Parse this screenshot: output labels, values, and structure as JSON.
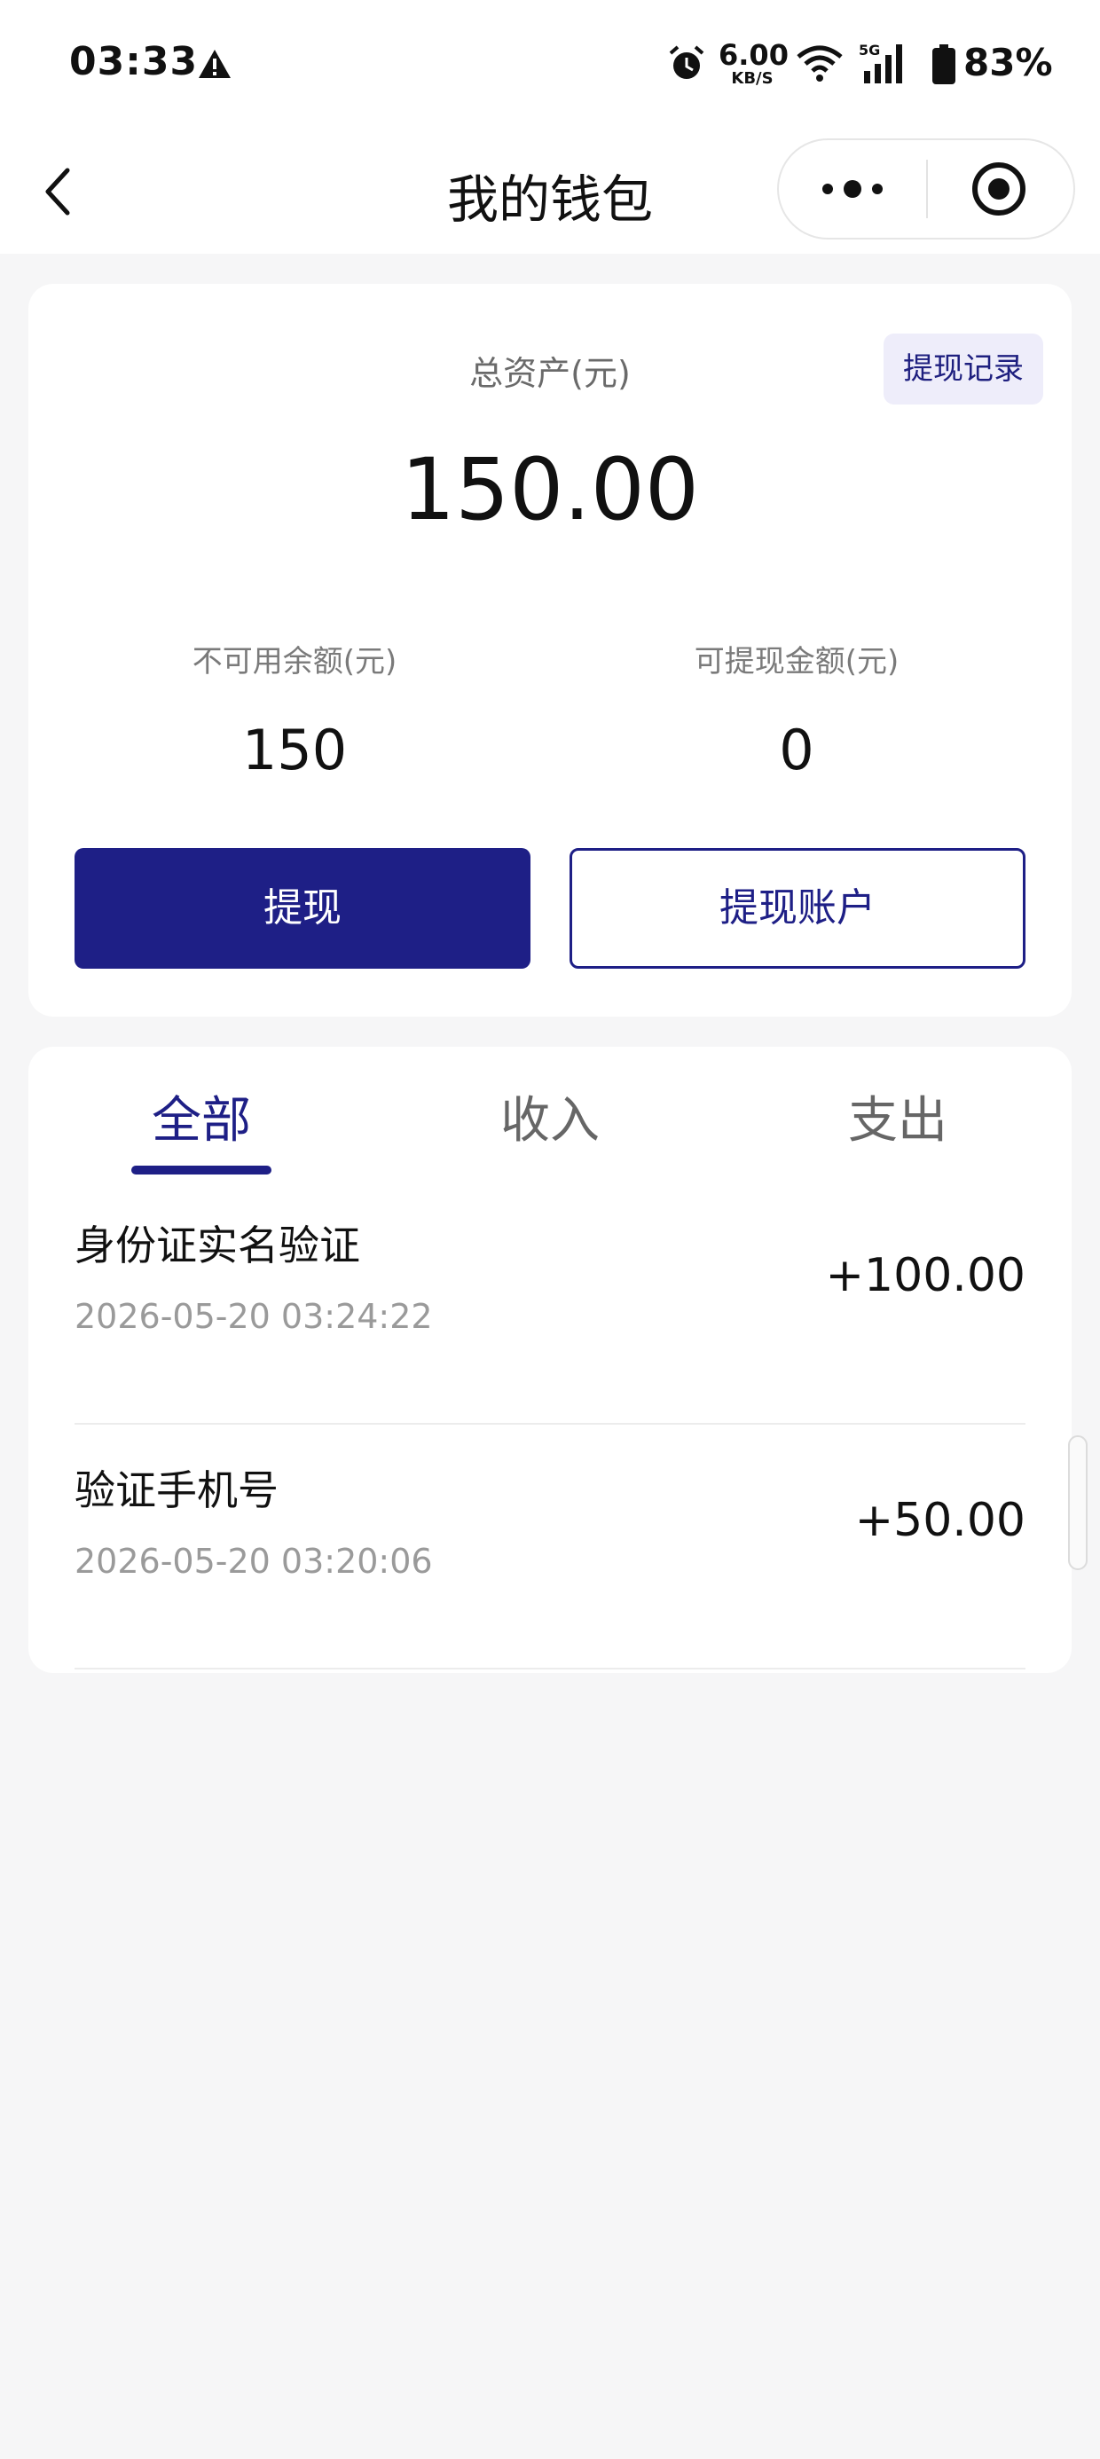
{
  "status_bar": {
    "time": "03:33",
    "net_speed_value": "6.00",
    "net_speed_unit": "KB/S",
    "network": "5G",
    "battery": "83%"
  },
  "nav": {
    "title": "我的钱包"
  },
  "wallet": {
    "total_label": "总资产(元)",
    "record_button": "提现记录",
    "total_amount": "150.00",
    "unavailable_label": "不可用余额(元)",
    "unavailable_value": "150",
    "withdrawable_label": "可提现金额(元)",
    "withdrawable_value": "0",
    "withdraw_button": "提现",
    "account_button": "提现账户"
  },
  "tabs": [
    {
      "label": "全部",
      "active": true
    },
    {
      "label": "收入",
      "active": false
    },
    {
      "label": "支出",
      "active": false
    }
  ],
  "transactions": [
    {
      "title": "身份证实名验证",
      "time": "2026-05-20 03:24:22",
      "amount": "+100.00"
    },
    {
      "title": "验证手机号",
      "time": "2026-05-20 03:20:06",
      "amount": "+50.00"
    }
  ],
  "colors": {
    "primary": "#1e1f86",
    "background": "#f6f6f7",
    "record_button_bg": "#eeedfa"
  }
}
